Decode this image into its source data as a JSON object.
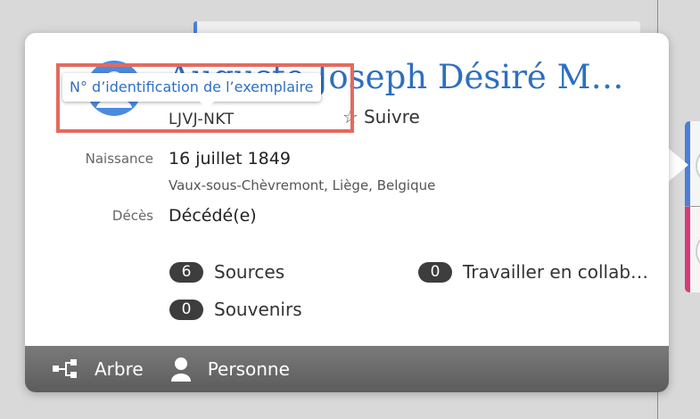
{
  "person": {
    "name": "Auguste Joseph Désiré M…",
    "id": "LJVJ-NKT",
    "follow_label": "Suivre"
  },
  "tooltip": {
    "text": "N° d’identification de l’exemplaire"
  },
  "vitals": {
    "birth_label": "Naissance",
    "birth_date": "16 juillet 1849",
    "birth_place": "Vaux-sous-Chèvremont, Liège, Belgique",
    "death_label": "Décès",
    "death_value": "Décédé(e)"
  },
  "stats": {
    "sources_count": "6",
    "sources_label": "Sources",
    "memories_count": "0",
    "memories_label": "Souvenirs",
    "collab_count": "0",
    "collab_label": "Travailler en collab…"
  },
  "footer": {
    "tree_label": "Arbre",
    "person_label": "Personne"
  },
  "icons": {
    "avatar": "person-avatar-icon",
    "follow": "star-icon",
    "tree": "tree-icon",
    "person": "person-icon"
  },
  "colors": {
    "accent": "#2d6fc1",
    "footer": "#666666",
    "badge": "#3d3d3d",
    "highlight": "#e46a5e"
  }
}
